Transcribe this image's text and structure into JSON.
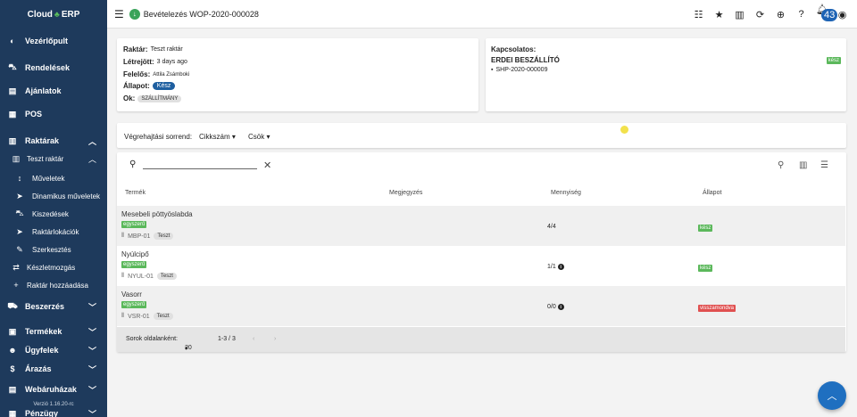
{
  "app": {
    "logo_left": "Cloud",
    "logo_right": "ERP",
    "version": "Verzió 1.16.20-rc"
  },
  "sidebar": {
    "items": [
      {
        "label": "Vezérlőpult",
        "icon": "dashboard-icon",
        "glyph": "◐"
      },
      {
        "label": "Rendelések",
        "icon": "cart-icon",
        "glyph": "🛒"
      },
      {
        "label": "Ajánlatok",
        "icon": "document-icon",
        "glyph": "▤"
      },
      {
        "label": "POS",
        "icon": "pos-icon",
        "glyph": "▦"
      },
      {
        "label": "Raktárak",
        "icon": "warehouse-icon",
        "glyph": "▥"
      },
      {
        "label": "Teszt raktár",
        "icon": "warehouse-sub-icon",
        "glyph": "▥"
      },
      {
        "label": "Műveletek",
        "icon": "arrows-icon",
        "glyph": "↕"
      },
      {
        "label": "Dinamikus műveletek",
        "icon": "send-icon",
        "glyph": "➤"
      },
      {
        "label": "Kiszedések",
        "icon": "cart-pick-icon",
        "glyph": "⛟"
      },
      {
        "label": "Raktárlokációk",
        "icon": "location-icon",
        "glyph": "➤"
      },
      {
        "label": "Szerkesztés",
        "icon": "wrench-icon",
        "glyph": "✎"
      },
      {
        "label": "Készletmozgás",
        "icon": "swap-icon",
        "glyph": "⇄"
      },
      {
        "label": "Raktár hozzáadása",
        "icon": "plus-icon",
        "glyph": "+"
      },
      {
        "label": "Beszerzés",
        "icon": "truck-icon",
        "glyph": "⛟"
      },
      {
        "label": "Termékek",
        "icon": "box-icon",
        "glyph": "▣"
      },
      {
        "label": "Ügyfelek",
        "icon": "users-icon",
        "glyph": "👥"
      },
      {
        "label": "Árazás",
        "icon": "dollar-icon",
        "glyph": "$"
      },
      {
        "label": "Webáruházak",
        "icon": "store-icon",
        "glyph": "▤"
      },
      {
        "label": "Pénzügy",
        "icon": "finance-icon",
        "glyph": "▦"
      }
    ]
  },
  "topbar": {
    "title": "Bevételezés WOP-2020-000028",
    "notification_count": "43"
  },
  "info": {
    "warehouse_label": "Raktár:",
    "warehouse_value": "Teszt raktár",
    "created_label": "Létrejött:",
    "created_value": "3 days ago",
    "owner_label": "Felelős:",
    "owner_value": "Attila Zsámboki",
    "status_label": "Állapot:",
    "status_value": "Kész",
    "reason_label": "Ok:",
    "reason_value": "SZÁLLÍTMÁNY"
  },
  "related": {
    "title": "Kapcsolatos:",
    "name": "ERDEI BESZÁLLÍTÓ",
    "ref": "SHP-2020-000009",
    "status": "kész"
  },
  "sort": {
    "label": "Végrehajtási sorrend:",
    "option1": "Cikkszám",
    "option2": "Csök"
  },
  "table": {
    "headers": [
      "Termék",
      "Megjegyzés",
      "Mennyiség",
      "Állapot"
    ],
    "rows": [
      {
        "name": "Mesebeli pöttyöslabda",
        "tag": "egyszerű",
        "sku": "MBP-01",
        "wh": "Teszt",
        "qty": "4/4",
        "status": "kész",
        "status_type": "ok"
      },
      {
        "name": "Nyúlcipő",
        "tag": "egyszerű",
        "sku": "NYUL-01",
        "wh": "Teszt",
        "qty": "1/1",
        "status": "kész",
        "status_type": "ok"
      },
      {
        "name": "Vasorr",
        "tag": "egyszerű",
        "sku": "VSR-01",
        "wh": "Teszt",
        "qty": "0/0",
        "status": "visszamondva",
        "status_type": "cancel"
      }
    ],
    "rows_per_page_label": "Sorok oldalanként:",
    "rows_per_page": "20",
    "range": "1-3 / 3"
  },
  "colors": {
    "sidebar": "#1e3a5c",
    "accent": "#1f6fc0",
    "ok": "#5bb85b",
    "cancel": "#e05050"
  }
}
